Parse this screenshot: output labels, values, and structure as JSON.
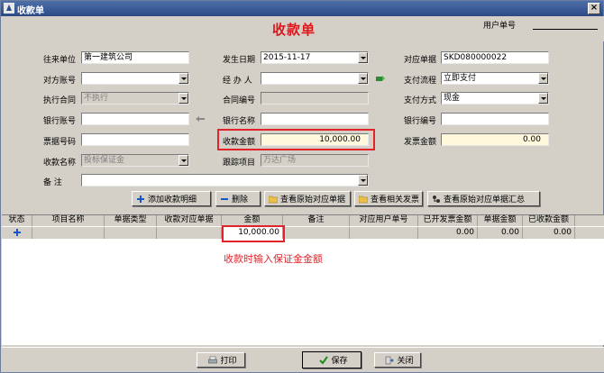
{
  "window": {
    "title": "收款单",
    "close_glyph": "×"
  },
  "header": {
    "form_title": "收款单",
    "user_no_label": "用户单号"
  },
  "fields": {
    "counterparty_label": "往来单位",
    "counterparty_value": "第一建筑公司",
    "occur_date_label": "发生日期",
    "occur_date_value": "2015-11-17",
    "related_doc_label": "对应单据",
    "related_doc_value": "SKD080000022",
    "account_label": "对方账号",
    "account_value": "",
    "handler_label": "经 办 人",
    "handler_value": "",
    "pay_flow_label": "支付流程",
    "pay_flow_value": "立即支付",
    "contract_label": "执行合同",
    "contract_value": "不执行",
    "contract_no_label": "合同编号",
    "contract_no_value": "",
    "pay_method_label": "支付方式",
    "pay_method_value": "现金",
    "bank_account_label": "银行账号",
    "bank_account_value": "",
    "bank_name_label": "银行名称",
    "bank_name_value": "",
    "bank_code_label": "银行编号",
    "bank_code_value": "",
    "ticket_no_label": "票据号码",
    "ticket_no_value": "",
    "amount_label": "收款金额",
    "amount_value": "10,000.00",
    "invoice_amount_label": "发票金额",
    "invoice_amount_value": "0.00",
    "receipt_name_label": "收款名称",
    "receipt_name_value": "投标保证金",
    "track_project_label": "跟踪项目",
    "track_project_value": "万达广场",
    "remark_label": "备    注",
    "remark_value": ""
  },
  "toolbar": {
    "add_detail": "添加收款明细",
    "delete_detail": "删除",
    "view_original": "查看原始对应单据",
    "view_invoice": "查看相关发票",
    "view_summary": "查看原始对应单据汇总"
  },
  "grid": {
    "headers": [
      "状态",
      "项目名称",
      "单据类型",
      "收款对应单据",
      "金额",
      "备注",
      "对应用户单号",
      "已开发票金额",
      "单据金额",
      "已收款金额"
    ],
    "row": {
      "amount": "10,000.00",
      "invoiced": "0.00",
      "doc_amount": "0.00",
      "received": "0.00"
    }
  },
  "annotation": "收款时输入保证金金额",
  "buttons": {
    "print": "打印",
    "save": "保存",
    "close": "关闭"
  },
  "colors": {
    "accent_red": "#e2141a",
    "title_bar": "#2b4a86"
  }
}
